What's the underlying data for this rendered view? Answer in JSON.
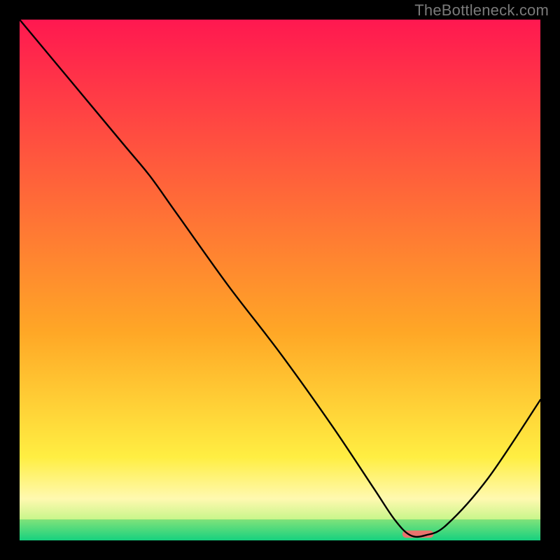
{
  "watermark": "TheBottleneck.com",
  "chart_data": {
    "type": "line",
    "title": "",
    "xlabel": "",
    "ylabel": "",
    "xlim": [
      0,
      100
    ],
    "ylim": [
      0,
      100
    ],
    "x": [
      0,
      10,
      20,
      25,
      30,
      40,
      50,
      60,
      68,
      72,
      75,
      78,
      82,
      90,
      100
    ],
    "values": [
      100,
      88,
      76,
      70,
      63,
      49,
      36,
      22,
      10,
      4,
      1,
      1,
      3,
      12,
      27
    ],
    "marker": {
      "x": 76.5,
      "y": 1.2,
      "width": 6,
      "height": 1.4
    },
    "gradient_bands": [
      {
        "y0": 0,
        "y1": 60,
        "from": "#ff1850",
        "to": "#ffa726"
      },
      {
        "y0": 60,
        "y1": 84,
        "from": "#ffa726",
        "to": "#ffee42"
      },
      {
        "y0": 84,
        "y1": 92,
        "from": "#ffee42",
        "to": "#fff9b0"
      },
      {
        "y0": 92,
        "y1": 96,
        "from": "#fff9b0",
        "to": "#c8f58a"
      },
      {
        "y0": 96,
        "y1": 100,
        "from": "#7fe27a",
        "to": "#16d17f"
      }
    ]
  }
}
